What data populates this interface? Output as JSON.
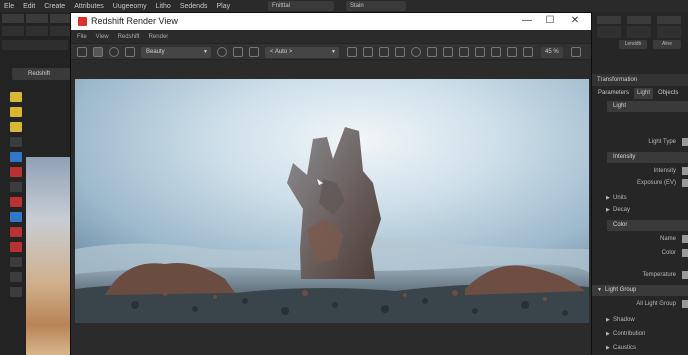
{
  "host_app": {
    "menu_items": [
      "Ele",
      "Edit",
      "Create",
      "Attributes",
      "Uugeeomy",
      "Litho",
      "Sedends",
      "Play"
    ],
    "pills": [
      {
        "label": "Fnitttal"
      },
      {
        "label": "Stain"
      }
    ],
    "left_panel": {
      "render_button_label": "Redshift"
    },
    "right_panel": {
      "header_pills": [
        "Lenddb",
        "Alne"
      ],
      "section_title": "Transformation",
      "tabs": [
        "Parameters",
        "Light",
        "Objects"
      ],
      "light_header": "Light",
      "light_type_label": "Light Type",
      "intensity_header": "Intensity",
      "intensity_label": "Intensity",
      "exposure_label": "Exposure (EV)",
      "units_label": "Units",
      "decay_label": "Decay",
      "color_header": "Color",
      "name_label": "Name",
      "color_label": "Color",
      "temperature_label": "Temperature",
      "light_group_header": "Light Group",
      "all_light_group_label": "All Light Group",
      "shadow_label": "Shadow",
      "contribution_label": "Contribution",
      "caustics_label": "Caustics"
    }
  },
  "render_view": {
    "title": "Redshift Render View",
    "menu": [
      "File",
      "View",
      "Redshift",
      "Render"
    ],
    "toolbar": {
      "display_dropdown": "Beauty",
      "aov_dropdown": "< Auto >",
      "zoom_label": "45 %"
    },
    "window_controls": {
      "minimize": "—",
      "maximize": "☐",
      "close": "✕"
    }
  },
  "colors": {
    "redshift_brand": "#d7332c",
    "accent_blue": "#2f78c7",
    "accent_yellow": "#d7b733"
  },
  "scene": {
    "description_icon": "rock-hand-sculpture-in-fog"
  }
}
